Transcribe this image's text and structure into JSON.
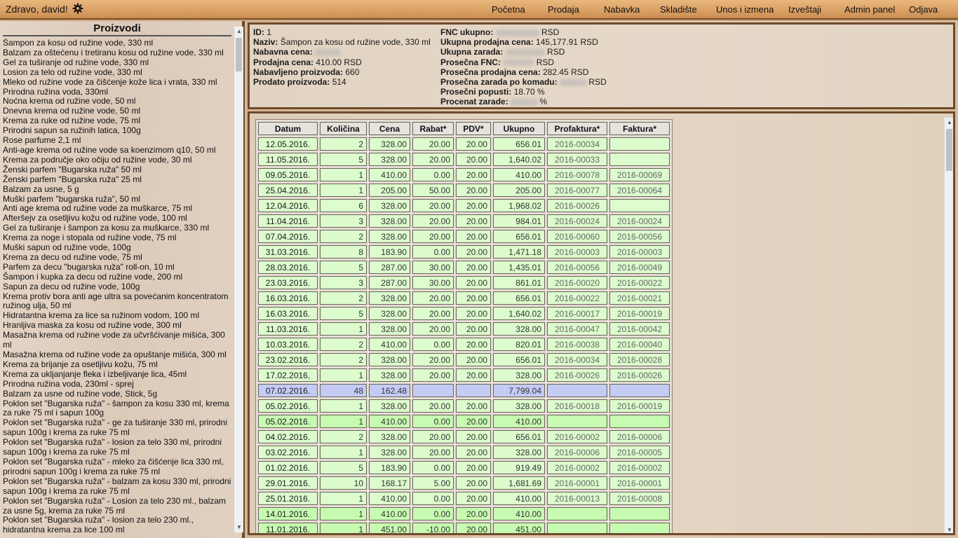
{
  "header": {
    "greeting": "Zdravo, david!",
    "settings_icon": "gear-icon",
    "nav": [
      "Početna",
      "Prodaja",
      "Nabavka",
      "Skladište",
      "Unos i izmena",
      "Izveštaji",
      "Admin panel",
      "Odjava"
    ]
  },
  "products": {
    "title": "Proizvodi",
    "items": [
      "Šampon za kosu od ružine vode, 330 ml",
      "Balzam za oštećenu i tretiranu kosu od ružine vode, 330 ml",
      "Gel za tuširanje od ružine vode, 330 ml",
      "Losion za telo od ružine vode, 330 ml",
      "Mleko od ružine vode za čišćenje kože lica i vrata, 330 ml",
      "Prirodna ružina voda, 330ml",
      "Noćna krema od ružine vode, 50 ml",
      "Dnevna krema od ružine vode, 50 ml",
      "Krema za ruke od ružine vode, 75 ml",
      "Prirodni sapun sa ružinih latica, 100g",
      "Rose parfume 2,1 ml",
      "Anti-age krema od ružine vode sa koenzimom q10, 50 ml",
      "Krema za područje oko očiju od ružine vode, 30 ml",
      "Ženski parfem \"Bugarska ruža\" 50 ml",
      "Ženski parfem \"Bugarska ruža\" 25 ml",
      "Balzam za usne, 5 g",
      "Muški parfem \"bugarska ruža\", 50 ml",
      "Anti age krema od ružine vode za muškarce, 75 ml",
      "Afteršejv za osetljivu kožu od ružine vode, 100 ml",
      "Gel za tuširanje i šampon za kosu za muškarce, 330 ml",
      "Krema za noge i stopala od ružine vode, 75 ml",
      "Muški sapun od ružine vode, 100g",
      "Krema za decu od ružine vode, 75 ml",
      "Parfem za decu \"bugarska ruža\" roll-on, 10 ml",
      "Šampon i kupka za decu od ružine vode, 200 ml",
      "Sapun za decu od ružine vode, 100g",
      "Krema protiv bora anti age ultra sa povećanim koncentratom ružinog ulja, 50 ml",
      "Hidratantna krema za lice sa ružinom vodom, 100 ml",
      "Hranljiva maska za kosu od ružine vode, 300 ml",
      "Masažna krema od ružine vode za učvršćivanje mišića, 300 ml",
      "Masažna krema od ružine vode za opuštanje mišića, 300 ml",
      "Krema za brijanje za osetljivu kožu, 75 ml",
      "Krema za ukljanjanje fleka i izbeljivanje lica, 45ml",
      "Prirodna ružina voda, 230ml - sprej",
      "Balzam za usne od ružine vode, Stick, 5g",
      "Poklon set \"Bugarska ruža\" - šampon za kosu 330 ml, krema za ruke 75 ml i sapun 100g",
      "Poklon set \"Bugarska ruža\" - ge za tuširanje 330 ml, prirodni sapun 100g i krema za ruke 75 ml",
      "Poklon set \"Bugarska ruža\" - losion za telo 330 ml, prirodni sapun 100g i krema za ruke 75 ml",
      "Poklon set \"Bugarska ruža\" - mleko za čišćenje lica 330 ml, prirodni sapun 100g i krema za ruke 75 ml",
      "Poklon set \"Bugarska ruža\" - balzam za kosu 330 ml, prirodni sapun 100g i krema za ruke 75 ml",
      "Poklon set \"Bugarska ruža\" - Losion za telo 230 ml., balzam za usne 5g, krema za ruke 75 ml",
      "Poklon set \"Bugarska ruža\" - losion za telo 230 ml., hidratantna krema za lice 100 ml"
    ]
  },
  "details": {
    "id_label": "ID:",
    "id": "1",
    "name_label": "Naziv:",
    "name": "Šampon za kosu od ružine vode, 330 ml",
    "purchase_price_label": "Nabavna cena:",
    "sale_price_label": "Prodajna cena:",
    "sale_price": "410.00 RSD",
    "procured_label": "Nabavljeno proizvoda:",
    "procured": "660",
    "sold_label": "Prodato proizvoda:",
    "sold": "514",
    "fnc_total_label": "FNC ukupno:",
    "fnc_total_unit": "RSD",
    "total_sales_label": "Ukupna prodajna cena:",
    "total_sales": "145,177.91 RSD",
    "total_profit_label": "Ukupna zarada:",
    "total_profit_unit": "RSD",
    "avg_fnc_label": "Prosečna FNC:",
    "avg_fnc_unit": "RSD",
    "avg_sale_label": "Prosečna prodajna cena:",
    "avg_sale": "282.45 RSD",
    "avg_profit_label": "Prosečna zarada po komadu:",
    "avg_profit_unit": "RSD",
    "avg_discount_label": "Prosečni popusti:",
    "avg_discount": "18.70 %",
    "profit_percent_label": "Procenat zarade:",
    "profit_percent_unit": "%"
  },
  "sales_table": {
    "headers": [
      "Datum",
      "Količina",
      "Cena",
      "Rabat*",
      "PDV*",
      "Ukupno",
      "Profaktura*",
      "Faktura*"
    ],
    "rows": [
      {
        "style": "green",
        "cells": [
          "12.05.2016.",
          "2",
          "328.00",
          "20.00",
          "20.00",
          "656.01",
          "2016-00034",
          ""
        ]
      },
      {
        "style": "green",
        "cells": [
          "11.05.2016.",
          "5",
          "328.00",
          "20.00",
          "20.00",
          "1,640.02",
          "2016-00033",
          ""
        ]
      },
      {
        "style": "green",
        "cells": [
          "09.05.2016.",
          "1",
          "410.00",
          "0.00",
          "20.00",
          "410.00",
          "2016-00078",
          "2016-00069"
        ]
      },
      {
        "style": "green",
        "cells": [
          "25.04.2016.",
          "1",
          "205.00",
          "50.00",
          "20.00",
          "205.00",
          "2016-00077",
          "2016-00064"
        ]
      },
      {
        "style": "green",
        "cells": [
          "12.04.2016.",
          "6",
          "328.00",
          "20.00",
          "20.00",
          "1,968.02",
          "2016-00026",
          ""
        ]
      },
      {
        "style": "green",
        "cells": [
          "11.04.2016.",
          "3",
          "328.00",
          "20.00",
          "20.00",
          "984.01",
          "2016-00024",
          "2016-00024"
        ]
      },
      {
        "style": "green",
        "cells": [
          "07.04.2016.",
          "2",
          "328.00",
          "20.00",
          "20.00",
          "656.01",
          "2016-00060",
          "2016-00056"
        ]
      },
      {
        "style": "green",
        "cells": [
          "31.03.2016.",
          "8",
          "183.90",
          "0.00",
          "20.00",
          "1,471.18",
          "2016-00003",
          "2016-00003"
        ]
      },
      {
        "style": "green",
        "cells": [
          "28.03.2016.",
          "5",
          "287.00",
          "30.00",
          "20.00",
          "1,435.01",
          "2016-00056",
          "2016-00049"
        ]
      },
      {
        "style": "green",
        "cells": [
          "23.03.2016.",
          "3",
          "287.00",
          "30.00",
          "20.00",
          "861.01",
          "2016-00020",
          "2016-00022"
        ]
      },
      {
        "style": "green",
        "cells": [
          "16.03.2016.",
          "2",
          "328.00",
          "20.00",
          "20.00",
          "656.01",
          "2016-00022",
          "2016-00021"
        ]
      },
      {
        "style": "green",
        "cells": [
          "16.03.2016.",
          "5",
          "328.00",
          "20.00",
          "20.00",
          "1,640.02",
          "2016-00017",
          "2016-00019"
        ]
      },
      {
        "style": "green",
        "cells": [
          "11.03.2016.",
          "1",
          "328.00",
          "20.00",
          "20.00",
          "328.00",
          "2016-00047",
          "2016-00042"
        ]
      },
      {
        "style": "green",
        "cells": [
          "10.03.2016.",
          "2",
          "410.00",
          "0.00",
          "20.00",
          "820.01",
          "2016-00038",
          "2016-00040"
        ]
      },
      {
        "style": "green",
        "cells": [
          "23.02.2016.",
          "2",
          "328.00",
          "20.00",
          "20.00",
          "656.01",
          "2016-00034",
          "2016-00028"
        ]
      },
      {
        "style": "green",
        "cells": [
          "17.02.2016.",
          "1",
          "328.00",
          "20.00",
          "20.00",
          "328.00",
          "2016-00026",
          "2016-00026"
        ]
      },
      {
        "style": "blue",
        "cells": [
          "07.02.2016.",
          "48",
          "162.48",
          "",
          "",
          "7,799.04",
          "",
          ""
        ]
      },
      {
        "style": "green",
        "cells": [
          "05.02.2016.",
          "1",
          "328.00",
          "20.00",
          "20.00",
          "328.00",
          "2016-00018",
          "2016-00019"
        ]
      },
      {
        "style": "green2",
        "cells": [
          "05.02.2016.",
          "1",
          "410.00",
          "0.00",
          "20.00",
          "410.00",
          "",
          ""
        ]
      },
      {
        "style": "green",
        "cells": [
          "04.02.2016.",
          "2",
          "328.00",
          "20.00",
          "20.00",
          "656.01",
          "2016-00002",
          "2016-00006"
        ]
      },
      {
        "style": "green",
        "cells": [
          "03.02.2016.",
          "1",
          "328.00",
          "20.00",
          "20.00",
          "328.00",
          "2016-00006",
          "2016-00005"
        ]
      },
      {
        "style": "green",
        "cells": [
          "01.02.2016.",
          "5",
          "183.90",
          "0.00",
          "20.00",
          "919.49",
          "2016-00002",
          "2016-00002"
        ]
      },
      {
        "style": "green",
        "cells": [
          "29.01.2016.",
          "10",
          "168.17",
          "5.00",
          "20.00",
          "1,681.69",
          "2016-00001",
          "2016-00001"
        ]
      },
      {
        "style": "green",
        "cells": [
          "25.01.2016.",
          "1",
          "410.00",
          "0.00",
          "20.00",
          "410.00",
          "2016-00013",
          "2016-00008"
        ]
      },
      {
        "style": "green2",
        "cells": [
          "14.01.2016.",
          "1",
          "410.00",
          "0.00",
          "20.00",
          "410.00",
          "",
          ""
        ]
      },
      {
        "style": "green2",
        "cells": [
          "11.01.2016.",
          "1",
          "451.00",
          "-10.00",
          "20.00",
          "451.00",
          "",
          ""
        ]
      }
    ]
  }
}
